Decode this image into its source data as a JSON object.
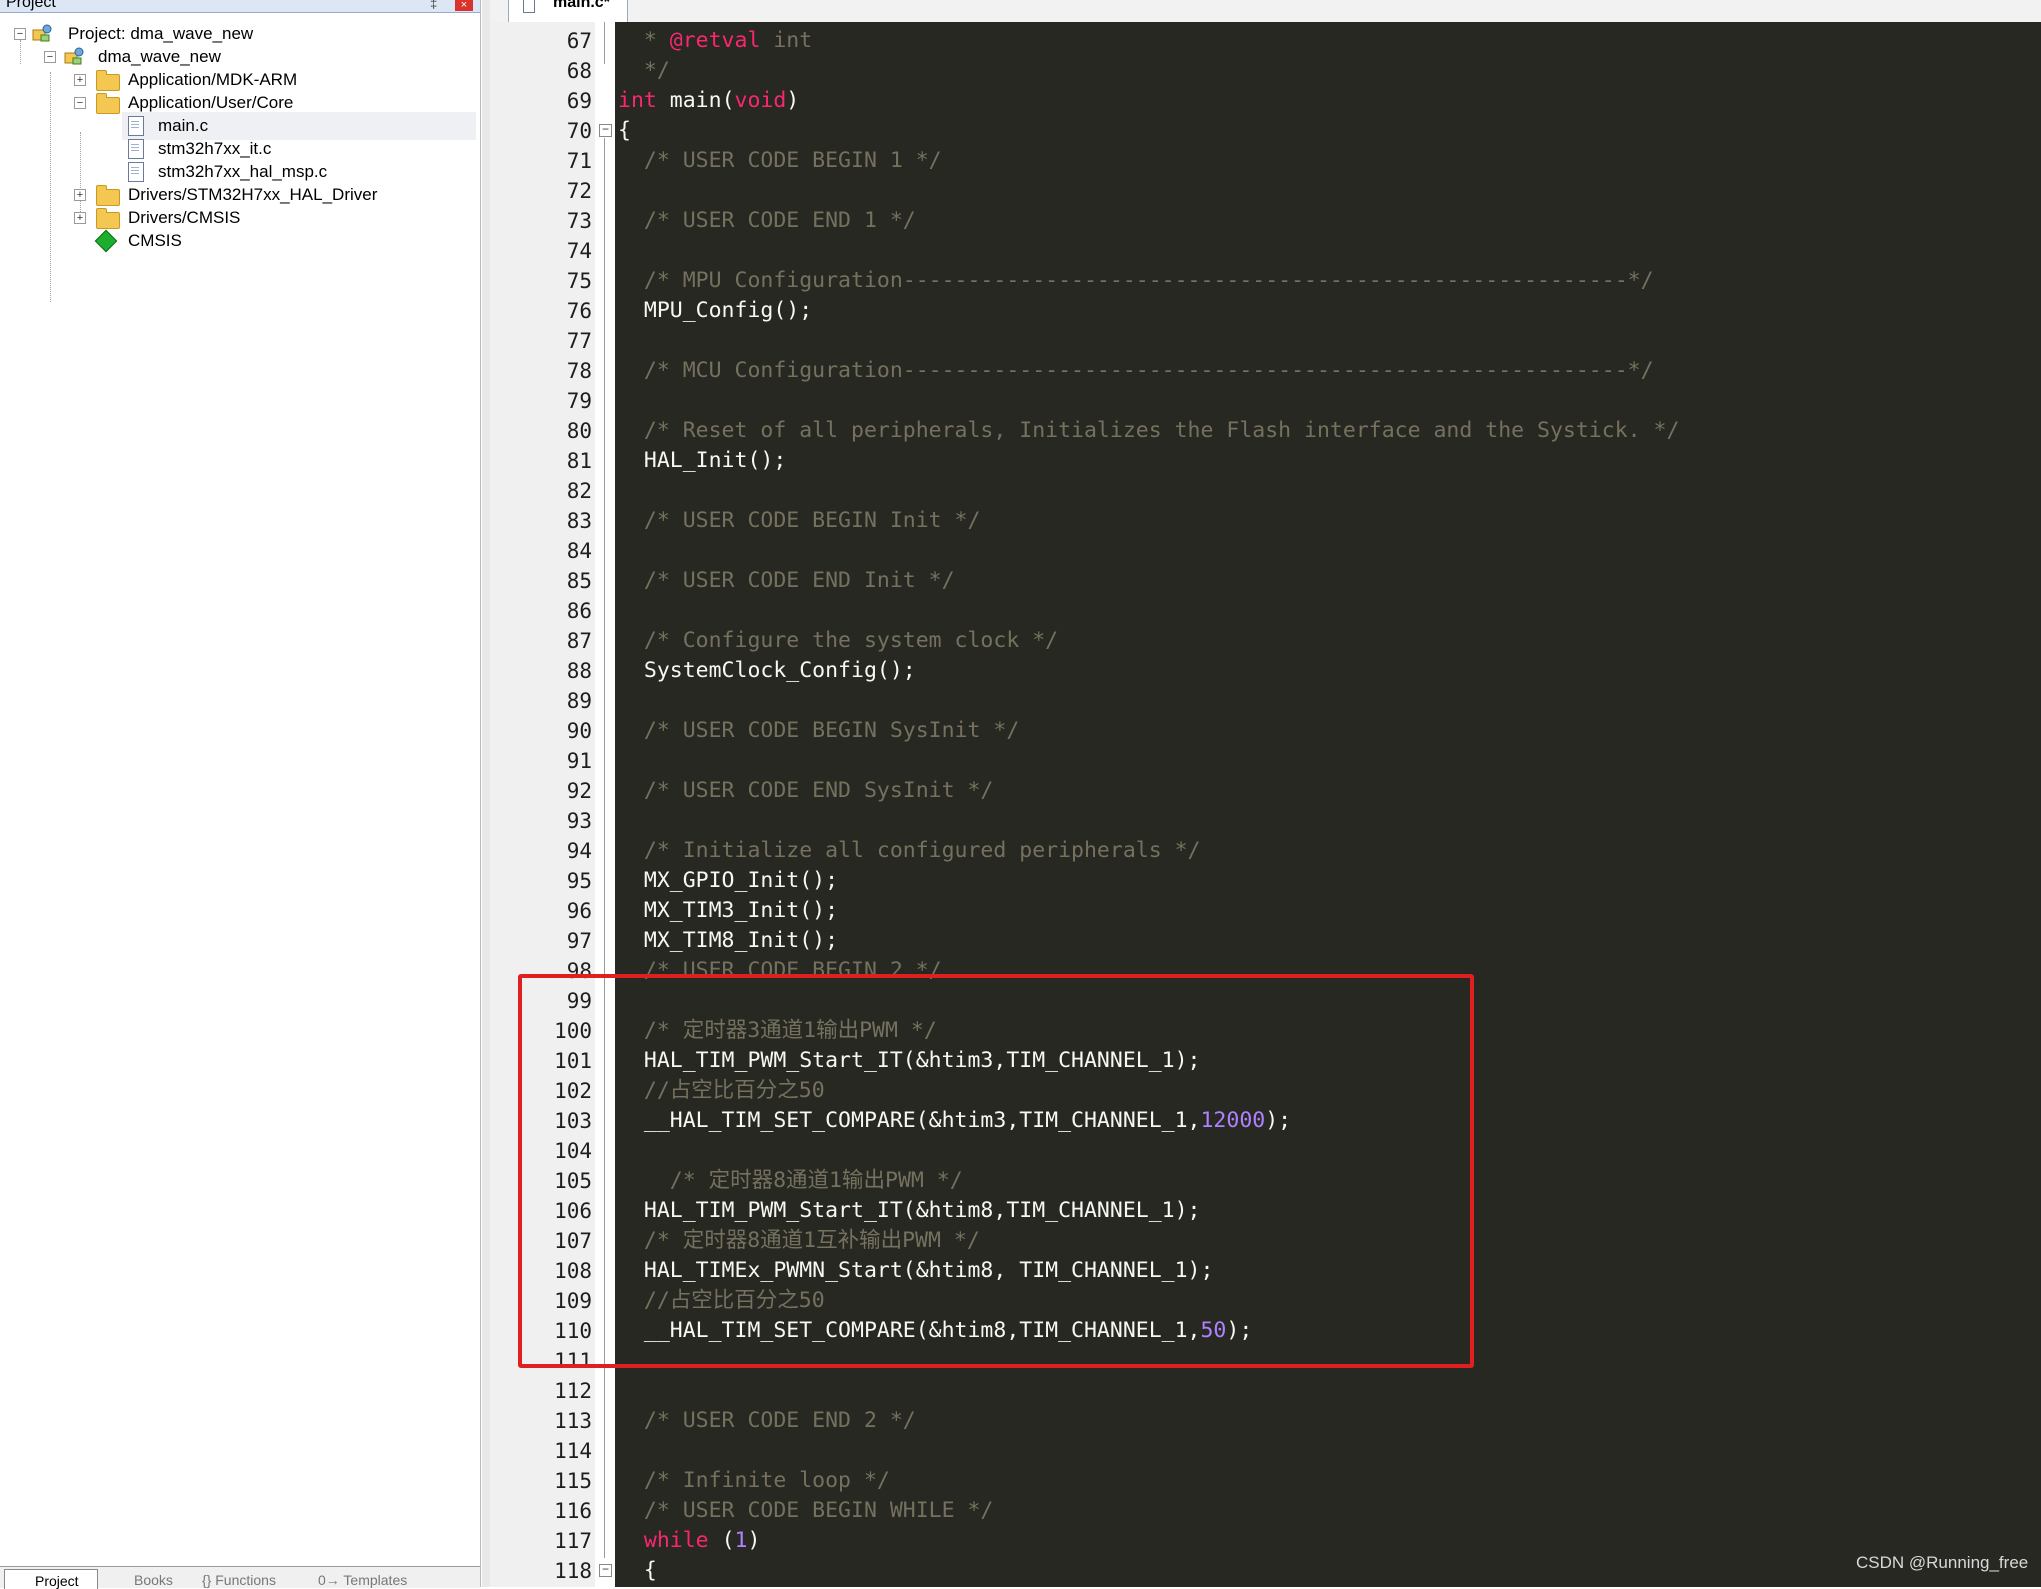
{
  "project_panel": {
    "title": "Project",
    "pin_glyph": "‡",
    "close_glyph": "×",
    "tree": [
      {
        "label": "Project: dma_wave_new",
        "icon": "project-icon",
        "toggle": "−"
      },
      {
        "label": "dma_wave_new",
        "icon": "target-icon",
        "toggle": "−"
      },
      {
        "label": "Application/MDK-ARM",
        "icon": "folder-icon",
        "toggle": "+"
      },
      {
        "label": "Application/User/Core",
        "icon": "folder-open-icon",
        "toggle": "−"
      },
      {
        "label": "main.c",
        "icon": "file-icon",
        "toggle": ""
      },
      {
        "label": "stm32h7xx_it.c",
        "icon": "file-icon",
        "toggle": ""
      },
      {
        "label": "stm32h7xx_hal_msp.c",
        "icon": "file-icon",
        "toggle": ""
      },
      {
        "label": "Drivers/STM32H7xx_HAL_Driver",
        "icon": "folder-icon",
        "toggle": "+"
      },
      {
        "label": "Drivers/CMSIS",
        "icon": "folder-icon",
        "toggle": "+"
      },
      {
        "label": "CMSIS",
        "icon": "cmsis-icon",
        "toggle": ""
      }
    ],
    "bottom_tabs": [
      "Project",
      "Books",
      "{} Functions",
      "0→ Templates"
    ]
  },
  "editor": {
    "tab_label": "main.c*",
    "fold_glyph": "−",
    "lines": [
      {
        "n": "67",
        "parts": [
          {
            "t": "  * ",
            "c": "cm"
          },
          {
            "t": "@retval",
            "c": "kw"
          },
          {
            "t": " int",
            "c": "cm"
          }
        ]
      },
      {
        "n": "68",
        "parts": [
          {
            "t": "  */",
            "c": "cm"
          }
        ]
      },
      {
        "n": "69",
        "parts": [
          {
            "t": "int",
            "c": "kw"
          },
          {
            "t": " main(",
            "c": ""
          },
          {
            "t": "void",
            "c": "kw"
          },
          {
            "t": ")",
            "c": ""
          }
        ]
      },
      {
        "n": "70",
        "parts": [
          {
            "t": "{",
            "c": ""
          }
        ]
      },
      {
        "n": "71",
        "parts": [
          {
            "t": "  /* USER CODE BEGIN 1 */",
            "c": "cm"
          }
        ]
      },
      {
        "n": "72",
        "parts": []
      },
      {
        "n": "73",
        "parts": [
          {
            "t": "  /* USER CODE END 1 */",
            "c": "cm"
          }
        ]
      },
      {
        "n": "74",
        "parts": []
      },
      {
        "n": "75",
        "parts": [
          {
            "t": "  /* MPU Configuration--------------------------------------------------------*/",
            "c": "cm"
          }
        ]
      },
      {
        "n": "76",
        "parts": [
          {
            "t": "  MPU_Config();",
            "c": ""
          }
        ]
      },
      {
        "n": "77",
        "parts": []
      },
      {
        "n": "78",
        "parts": [
          {
            "t": "  /* MCU Configuration--------------------------------------------------------*/",
            "c": "cm"
          }
        ]
      },
      {
        "n": "79",
        "parts": []
      },
      {
        "n": "80",
        "parts": [
          {
            "t": "  /* Reset of all peripherals, Initializes the Flash interface and the Systick. */",
            "c": "cm"
          }
        ]
      },
      {
        "n": "81",
        "parts": [
          {
            "t": "  HAL_Init();",
            "c": ""
          }
        ]
      },
      {
        "n": "82",
        "parts": []
      },
      {
        "n": "83",
        "parts": [
          {
            "t": "  /* USER CODE BEGIN Init */",
            "c": "cm"
          }
        ]
      },
      {
        "n": "84",
        "parts": []
      },
      {
        "n": "85",
        "parts": [
          {
            "t": "  /* USER CODE END Init */",
            "c": "cm"
          }
        ]
      },
      {
        "n": "86",
        "parts": []
      },
      {
        "n": "87",
        "parts": [
          {
            "t": "  /* Configure the system clock */",
            "c": "cm"
          }
        ]
      },
      {
        "n": "88",
        "parts": [
          {
            "t": "  SystemClock_Config();",
            "c": ""
          }
        ]
      },
      {
        "n": "89",
        "parts": []
      },
      {
        "n": "90",
        "parts": [
          {
            "t": "  /* USER CODE BEGIN SysInit */",
            "c": "cm"
          }
        ]
      },
      {
        "n": "91",
        "parts": []
      },
      {
        "n": "92",
        "parts": [
          {
            "t": "  /* USER CODE END SysInit */",
            "c": "cm"
          }
        ]
      },
      {
        "n": "93",
        "parts": []
      },
      {
        "n": "94",
        "parts": [
          {
            "t": "  /* Initialize all configured peripherals */",
            "c": "cm"
          }
        ]
      },
      {
        "n": "95",
        "parts": [
          {
            "t": "  MX_GPIO_Init();",
            "c": ""
          }
        ]
      },
      {
        "n": "96",
        "parts": [
          {
            "t": "  MX_TIM3_Init();",
            "c": ""
          }
        ]
      },
      {
        "n": "97",
        "parts": [
          {
            "t": "  MX_TIM8_Init();",
            "c": ""
          }
        ]
      },
      {
        "n": "98",
        "parts": [
          {
            "t": "  /* USER CODE BEGIN 2 */",
            "c": "cm"
          }
        ]
      },
      {
        "n": "99",
        "parts": []
      },
      {
        "n": "100",
        "parts": [
          {
            "t": "  /* 定时器3通道1输出PWM */",
            "c": "cm"
          }
        ]
      },
      {
        "n": "101",
        "parts": [
          {
            "t": "  HAL_TIM_PWM_Start_IT(&htim3,TIM_CHANNEL_1);",
            "c": ""
          }
        ]
      },
      {
        "n": "102",
        "parts": [
          {
            "t": "  //占空比百分之50",
            "c": "cm"
          }
        ]
      },
      {
        "n": "103",
        "parts": [
          {
            "t": "  __HAL_TIM_SET_COMPARE(&htim3,TIM_CHANNEL_1,",
            "c": ""
          },
          {
            "t": "12000",
            "c": "num"
          },
          {
            "t": ");",
            "c": ""
          }
        ]
      },
      {
        "n": "104",
        "parts": []
      },
      {
        "n": "105",
        "parts": [
          {
            "t": "    /* 定时器8通道1输出PWM */",
            "c": "cm"
          }
        ]
      },
      {
        "n": "106",
        "parts": [
          {
            "t": "  HAL_TIM_PWM_Start_IT(&htim8,TIM_CHANNEL_1);",
            "c": ""
          }
        ]
      },
      {
        "n": "107",
        "parts": [
          {
            "t": "  /* 定时器8通道1互补输出PWM */",
            "c": "cm"
          }
        ]
      },
      {
        "n": "108",
        "parts": [
          {
            "t": "  HAL_TIMEx_PWMN_Start(&htim8, TIM_CHANNEL_1);",
            "c": ""
          }
        ]
      },
      {
        "n": "109",
        "parts": [
          {
            "t": "  //占空比百分之50",
            "c": "cm"
          }
        ]
      },
      {
        "n": "110",
        "parts": [
          {
            "t": "  __HAL_TIM_SET_COMPARE(&htim8,TIM_CHANNEL_1,",
            "c": ""
          },
          {
            "t": "50",
            "c": "num"
          },
          {
            "t": ");",
            "c": ""
          }
        ]
      },
      {
        "n": "111",
        "parts": []
      },
      {
        "n": "112",
        "parts": []
      },
      {
        "n": "113",
        "parts": [
          {
            "t": "  /* USER CODE END 2 */",
            "c": "cm"
          }
        ]
      },
      {
        "n": "114",
        "parts": []
      },
      {
        "n": "115",
        "parts": [
          {
            "t": "  /* Infinite loop */",
            "c": "cm"
          }
        ]
      },
      {
        "n": "116",
        "parts": [
          {
            "t": "  /* USER CODE BEGIN WHILE */",
            "c": "cm"
          }
        ]
      },
      {
        "n": "117",
        "parts": [
          {
            "t": "  ",
            "c": ""
          },
          {
            "t": "while",
            "c": "kw"
          },
          {
            "t": " (",
            "c": ""
          },
          {
            "t": "1",
            "c": "num"
          },
          {
            "t": ")",
            "c": ""
          }
        ]
      },
      {
        "n": "118",
        "parts": [
          {
            "t": "  {",
            "c": ""
          }
        ]
      }
    ]
  },
  "watermark": "CSDN @Running_free",
  "colors": {
    "code_background": "#272822",
    "comment": "#75715e",
    "keyword": "#f92672",
    "number": "#ae81ff",
    "highlight_box": "#e02020"
  }
}
